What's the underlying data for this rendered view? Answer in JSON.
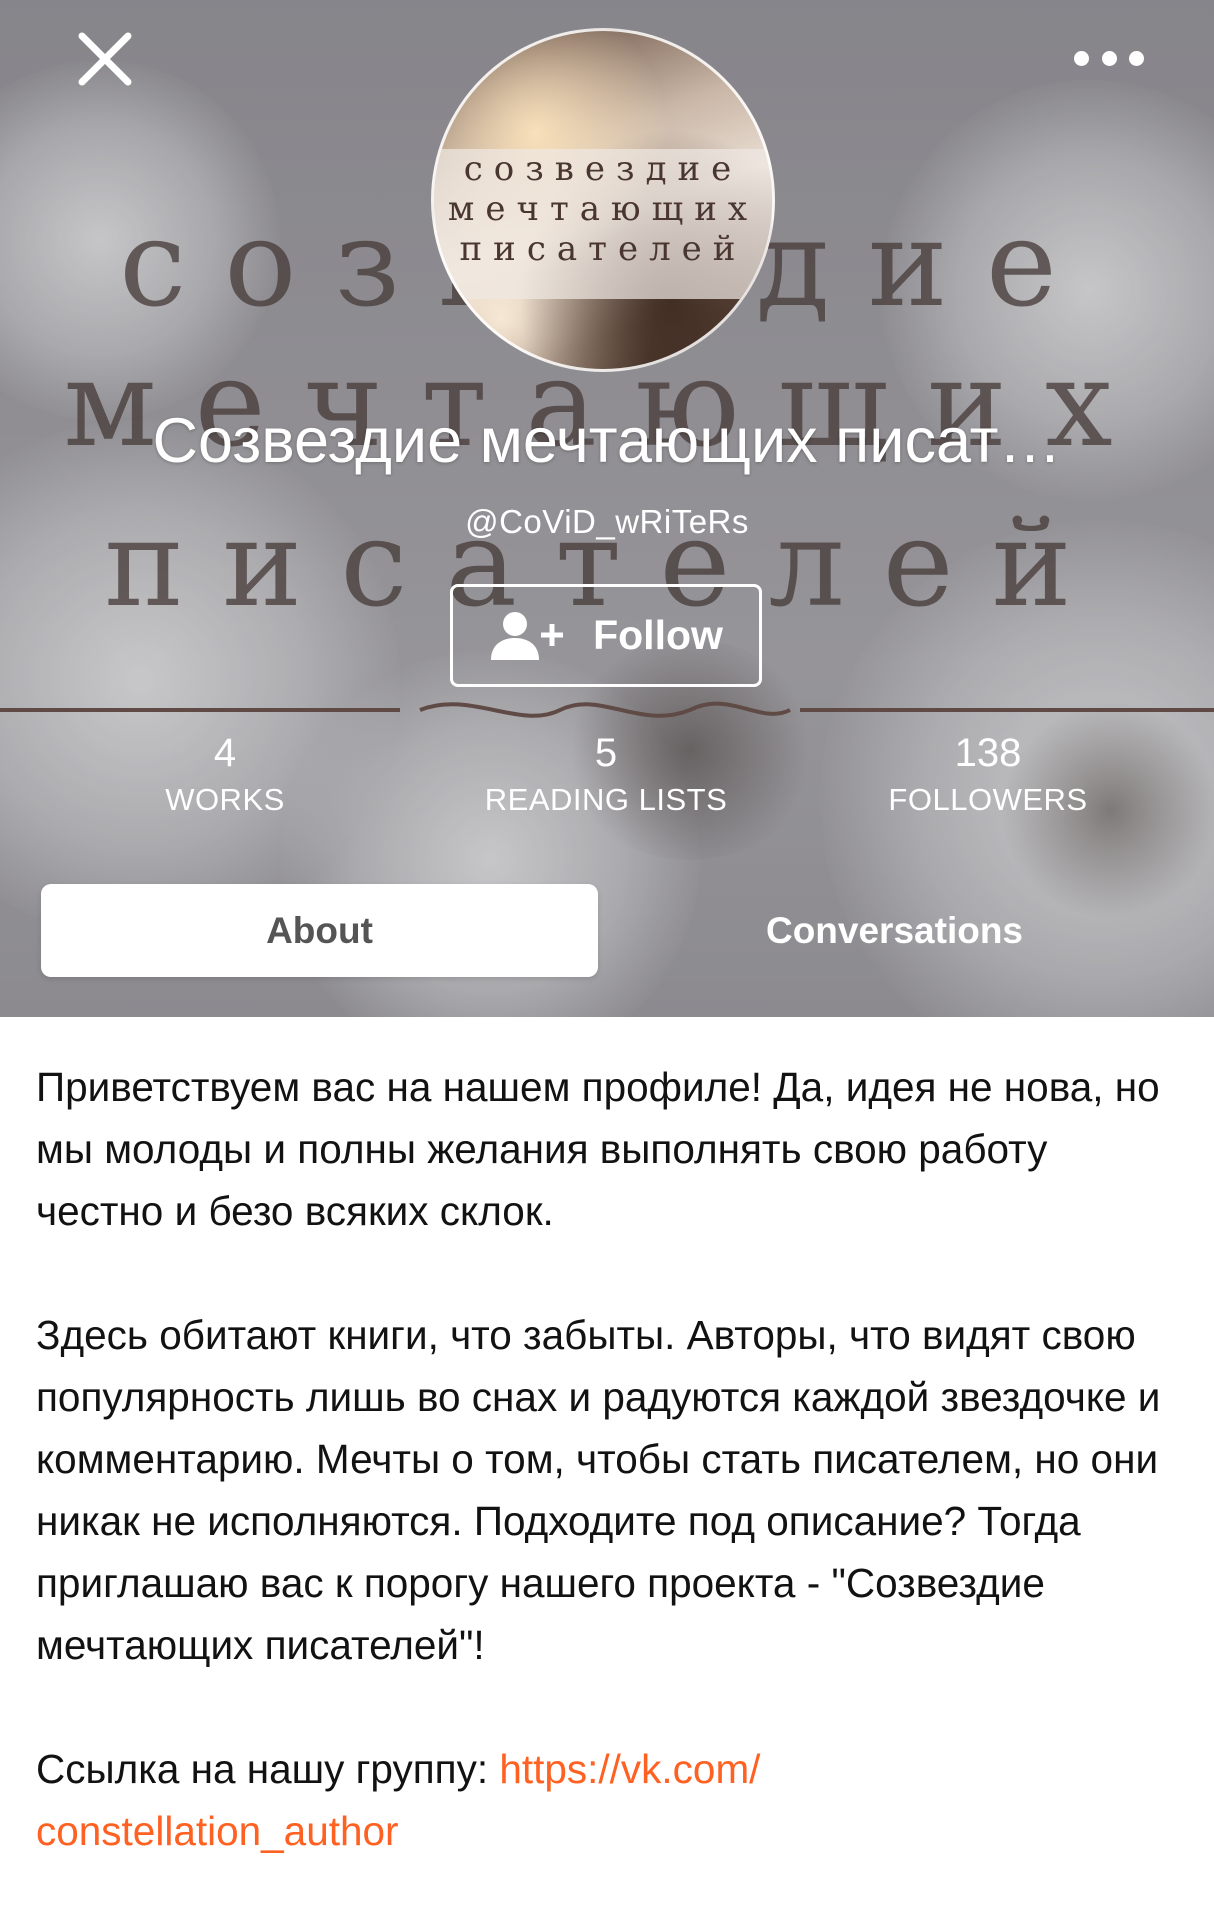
{
  "header": {
    "close_icon": "close-icon",
    "more_icon": "more-options-icon",
    "background_watermark_handle": "CoViD_wRiTeRs",
    "background_title_lines": [
      "созвездие",
      "мечтающих",
      "писателей"
    ]
  },
  "avatar": {
    "title_lines": [
      "созвездие",
      "мечтающих",
      "писателей"
    ]
  },
  "profile": {
    "name": "Созвездие мечтающих писат…",
    "username": "@CoViD_wRiTeRs",
    "follow_label": "Follow"
  },
  "stats": {
    "works": {
      "value": "4",
      "label": "WORKS"
    },
    "reading_lists": {
      "value": "5",
      "label": "READING LISTS"
    },
    "followers": {
      "value": "138",
      "label": "FOLLOWERS"
    }
  },
  "tabs": {
    "about": "About",
    "conversations": "Conversations",
    "active": "About"
  },
  "about": {
    "paragraph_1": "Приветствуем вас на нашем профиле! Да, идея не нова, но мы молоды и полны желания выполнять свою работу честно и безо всяких склок.",
    "paragraph_2": "Здесь обитают книги, что забыты. Авторы, что видят свою популярность лишь во снах и радуются каждой звездочке и комментарию. Мечты о том, чтобы стать писателем, но они никак не исполняются. Подходите под описание? Тогда приглашаю вас к порогу нашего проекта - \"Созвездие мечтающих писателей\"!",
    "link_intro": "Ссылка на нашу группу: ",
    "link_url_line1": "https://vk.com/",
    "link_url_line2": "constellation_author"
  },
  "colors": {
    "link": "#ff6122",
    "text": "#121212",
    "tab_active_bg": "#ffffff"
  }
}
